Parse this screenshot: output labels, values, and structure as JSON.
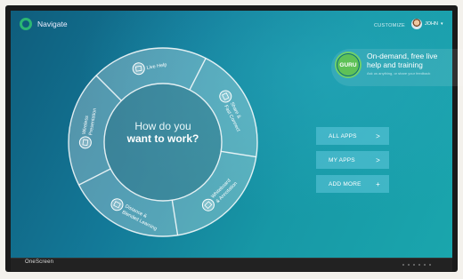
{
  "header": {
    "app_name": "Navigate",
    "customize_label": "CUSTOMIZE",
    "user_name": "JOHN",
    "user_caret": "▾"
  },
  "guru": {
    "badge": "GURU",
    "title": "On-demand, free live help and training",
    "subtitle": "Ask us anything, or share your feedback"
  },
  "wheel": {
    "center_line1": "How do you",
    "center_line2": "want to work?",
    "segments": [
      {
        "label_line1": "Live Help",
        "label_line2": "",
        "icon": "live-help-icon"
      },
      {
        "label_line1": "Share &",
        "label_line2": "Fast Connect",
        "icon": "share-icon"
      },
      {
        "label_line1": "Whiteboard",
        "label_line2": "& Annotation",
        "icon": "whiteboard-icon"
      },
      {
        "label_line1": "Distance &",
        "label_line2": "Blended Learning",
        "icon": "learning-icon"
      },
      {
        "label_line1": "Wireless",
        "label_line2": "Presentation",
        "icon": "presentation-icon"
      }
    ]
  },
  "actions": [
    {
      "label": "ALL APPS",
      "symbol": ">"
    },
    {
      "label": "MY APPS",
      "symbol": ">"
    },
    {
      "label": "ADD MORE",
      "symbol": "+"
    }
  ],
  "device": {
    "brand": "OneScreen"
  }
}
